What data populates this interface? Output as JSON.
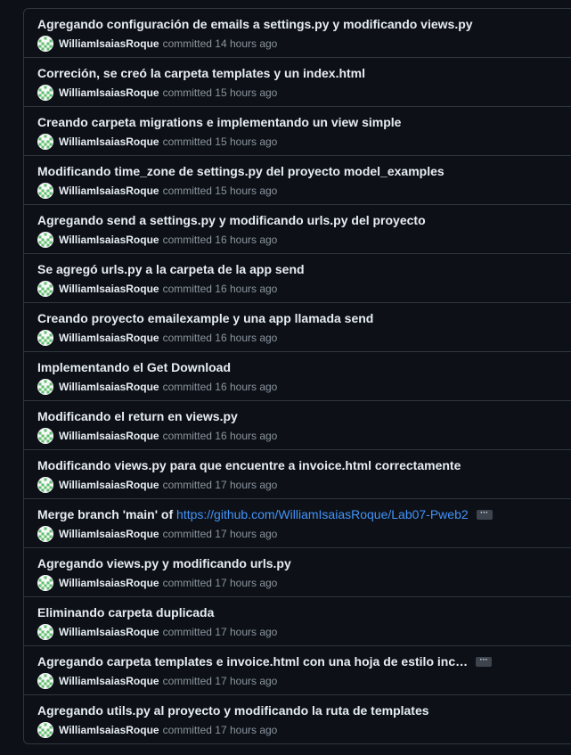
{
  "commits": [
    {
      "title": "Agregando configuración de emails a settings.py y modificando views.py",
      "author": "WilliamIsaiasRoque",
      "verb": "committed",
      "time": "14 hours ago"
    },
    {
      "title": "Correción, se creó la carpeta templates y un index.html",
      "author": "WilliamIsaiasRoque",
      "verb": "committed",
      "time": "15 hours ago"
    },
    {
      "title": "Creando carpeta migrations e implementando un view simple",
      "author": "WilliamIsaiasRoque",
      "verb": "committed",
      "time": "15 hours ago"
    },
    {
      "title": "Modificando time_zone de settings.py del proyecto model_examples",
      "author": "WilliamIsaiasRoque",
      "verb": "committed",
      "time": "15 hours ago"
    },
    {
      "title": "Agregando send a settings.py y modificando urls.py del proyecto",
      "author": "WilliamIsaiasRoque",
      "verb": "committed",
      "time": "16 hours ago"
    },
    {
      "title": "Se agregó urls.py a la carpeta de la app send",
      "author": "WilliamIsaiasRoque",
      "verb": "committed",
      "time": "16 hours ago"
    },
    {
      "title": "Creando proyecto emailexample y una app llamada send",
      "author": "WilliamIsaiasRoque",
      "verb": "committed",
      "time": "16 hours ago"
    },
    {
      "title": "Implementando el Get Download",
      "author": "WilliamIsaiasRoque",
      "verb": "committed",
      "time": "16 hours ago"
    },
    {
      "title": "Modificando el return en views.py",
      "author": "WilliamIsaiasRoque",
      "verb": "committed",
      "time": "16 hours ago"
    },
    {
      "title": "Modificando views.py para que encuentre a invoice.html correctamente",
      "author": "WilliamIsaiasRoque",
      "verb": "committed",
      "time": "17 hours ago"
    },
    {
      "title": "Merge branch 'main' of ",
      "link": "https://github.com/WilliamIsaiasRoque/Lab07-Pweb2",
      "ellipsis": "···",
      "author": "WilliamIsaiasRoque",
      "verb": "committed",
      "time": "17 hours ago"
    },
    {
      "title": "Agregando views.py y modificando urls.py",
      "author": "WilliamIsaiasRoque",
      "verb": "committed",
      "time": "17 hours ago"
    },
    {
      "title": "Eliminando carpeta duplicada",
      "author": "WilliamIsaiasRoque",
      "verb": "committed",
      "time": "17 hours ago"
    },
    {
      "title": "Agregando carpeta templates e invoice.html con una hoja de estilo inc…",
      "ellipsis": "···",
      "author": "WilliamIsaiasRoque",
      "verb": "committed",
      "time": "17 hours ago"
    },
    {
      "title": "Agregando utils.py al proyecto y modificando la ruta de templates",
      "author": "WilliamIsaiasRoque",
      "verb": "committed",
      "time": "17 hours ago"
    }
  ],
  "colors": {
    "background": "#0d1117",
    "border": "#30363d",
    "text_primary": "#e6edf3",
    "text_muted": "#8b949e",
    "link": "#4493f8",
    "avatar_green": "#5fbf6a"
  },
  "icons": {
    "avatar": "identicon-avatar-icon",
    "expand": "ellipsis-expand-icon"
  }
}
